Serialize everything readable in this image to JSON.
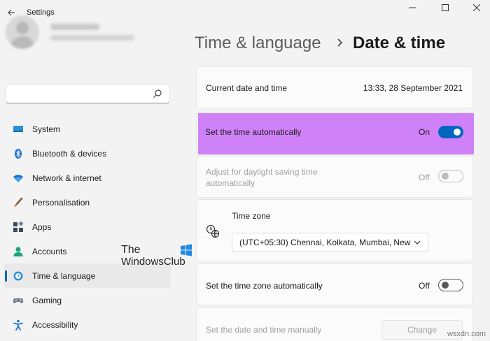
{
  "window": {
    "title": "Settings"
  },
  "search": {
    "placeholder": ""
  },
  "sidebar": {
    "items": [
      {
        "label": "System",
        "icon": "monitor-icon"
      },
      {
        "label": "Bluetooth & devices",
        "icon": "bluetooth-icon"
      },
      {
        "label": "Network & internet",
        "icon": "wifi-icon"
      },
      {
        "label": "Personalisation",
        "icon": "brush-icon"
      },
      {
        "label": "Apps",
        "icon": "apps-icon"
      },
      {
        "label": "Accounts",
        "icon": "person-icon"
      },
      {
        "label": "Time & language",
        "icon": "globe-clock-icon",
        "active": true
      },
      {
        "label": "Gaming",
        "icon": "gamepad-icon"
      },
      {
        "label": "Accessibility",
        "icon": "accessibility-icon"
      }
    ]
  },
  "watermark": {
    "line1": "The",
    "line2": "WindowsClub"
  },
  "breadcrumb": {
    "parent": "Time & language",
    "current": "Date & time"
  },
  "current_time": {
    "label": "Current date and time",
    "value": "13:33, 28 September 2021"
  },
  "auto_time": {
    "label": "Set the time automatically",
    "state": "On"
  },
  "dst": {
    "label_line1": "Adjust for daylight saving time",
    "label_line2": "automatically",
    "state": "Off"
  },
  "timezone": {
    "label": "Time zone",
    "value": "(UTC+05:30) Chennai, Kolkata, Mumbai, New"
  },
  "auto_timezone": {
    "label": "Set the time zone automatically",
    "state": "Off"
  },
  "manual_time": {
    "label": "Set the date and time manually",
    "button": "Change"
  },
  "site_watermark": "wsxdn.com",
  "colors": {
    "accent": "#0067c0",
    "highlight": "#cf82f8"
  }
}
